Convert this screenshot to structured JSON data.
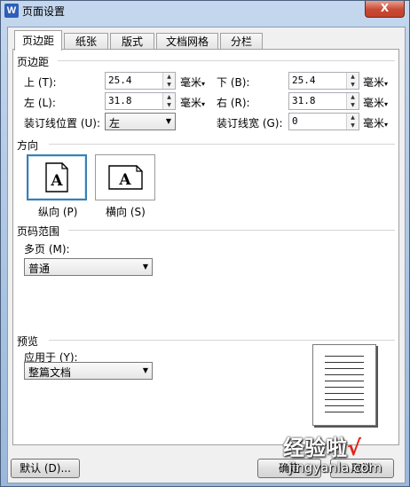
{
  "window": {
    "title": "页面设置",
    "close_label": "X"
  },
  "tabs": [
    {
      "label": "页边距",
      "active": true
    },
    {
      "label": "纸张",
      "active": false
    },
    {
      "label": "版式",
      "active": false
    },
    {
      "label": "文档网格",
      "active": false
    },
    {
      "label": "分栏",
      "active": false
    }
  ],
  "margins": {
    "section_title": "页边距",
    "top": {
      "label": "上 (T):",
      "value": "25.4",
      "unit": "毫米"
    },
    "bottom": {
      "label": "下 (B):",
      "value": "25.4",
      "unit": "毫米"
    },
    "left": {
      "label": "左 (L):",
      "value": "31.8",
      "unit": "毫米"
    },
    "right": {
      "label": "右 (R):",
      "value": "31.8",
      "unit": "毫米"
    },
    "gutter_position": {
      "label": "装订线位置 (U):",
      "value": "左"
    },
    "gutter": {
      "label": "装订线宽 (G):",
      "value": "0",
      "unit": "毫米"
    }
  },
  "orientation": {
    "section_title": "方向",
    "glyph": "A",
    "portrait_label": "纵向 (P)",
    "landscape_label": "横向 (S)",
    "selected": "portrait"
  },
  "page_range": {
    "section_title": "页码范围",
    "multiple_pages_label": "多页 (M):",
    "multiple_pages_value": "普通"
  },
  "preview": {
    "section_title": "预览",
    "apply_to_label": "应用于 (Y):",
    "apply_to_value": "整篇文档"
  },
  "buttons": {
    "default": "默认 (D)...",
    "ok": "确定",
    "cancel": "取消"
  },
  "watermark": {
    "text": "经验啦",
    "check": "√",
    "url": "jingyanla.com"
  }
}
